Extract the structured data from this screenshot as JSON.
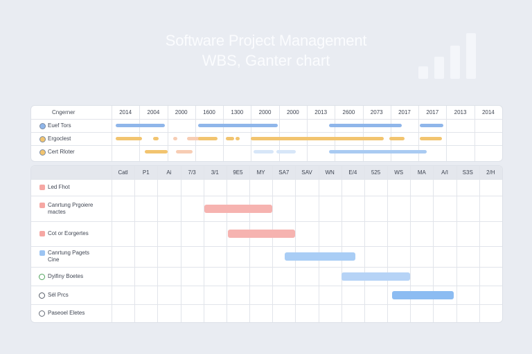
{
  "header": {
    "title": "Software Project Management",
    "subtitle": "WBS, Ganter chart"
  },
  "chart_data": [
    {
      "type": "gantt",
      "corner_label": "Cngerner",
      "columns": [
        "2014",
        "2004",
        "2000",
        "1600",
        "1300",
        "2000",
        "2000",
        "2013",
        "2600",
        "2073",
        "2017",
        "2017",
        "2013",
        "2014"
      ],
      "rows": [
        {
          "label": "Euef Tors",
          "marker": "dot",
          "color": "#8fb6ea",
          "segments": [
            [
              0.15,
              1.9
            ],
            [
              3.1,
              5.95
            ],
            [
              7.8,
              10.4
            ],
            [
              11.05,
              11.9
            ]
          ]
        },
        {
          "label": "Ergoclest",
          "marker": "dot",
          "color": "#f2c46f",
          "segments": [
            [
              0.15,
              1.1
            ],
            [
              1.5,
              1.7
            ],
            [
              2.2,
              2.35
            ],
            [
              2.7,
              3.3
            ],
            [
              3.1,
              3.8
            ],
            [
              4.1,
              4.4
            ],
            [
              4.45,
              4.6
            ],
            [
              5.0,
              9.75
            ],
            [
              9.95,
              10.5
            ],
            [
              11.05,
              11.85
            ]
          ]
        },
        {
          "label": "Cert Rloter",
          "marker": "dot",
          "color": "#f2c46f",
          "segments": [
            [
              1.2,
              2.0
            ],
            [
              2.3,
              2.9
            ],
            [
              5.1,
              5.8
            ],
            [
              5.9,
              6.6
            ],
            [
              7.8,
              11.3
            ]
          ]
        }
      ],
      "segment_colors": {
        "row2_extra": "#f7cdb4",
        "row3_light": "#d7e6f8"
      }
    },
    {
      "type": "gantt",
      "columns": [
        "Catl",
        "P1",
        "Ai",
        "7/3",
        "3/1",
        "9E5",
        "MY",
        "SA7",
        "SAV",
        "WN",
        "E/4",
        "525",
        "WS",
        "MA",
        "A/I",
        "S3S",
        "2/H"
      ],
      "corner_label": "",
      "rows": [
        {
          "label": "Led Fhot",
          "marker": "square",
          "color": "#f6a7a3",
          "start": null,
          "end": null
        },
        {
          "label": "Canrtung Prgoiere",
          "label2": "mactes",
          "marker": "square",
          "color": "#f6a7a3",
          "start": 4.05,
          "end": 7.0
        },
        {
          "label": "Cot or Eorgertes",
          "marker": "square",
          "color": "#f6a7a3",
          "start": 5.05,
          "end": 8.0
        },
        {
          "label": "Canrtung Pagets",
          "label2": "Cine",
          "marker": "square",
          "color": "#9cc4f2",
          "start": 7.55,
          "end": 10.6
        },
        {
          "label": "Dyifiny Boetes",
          "marker": "ring",
          "color": "#4fa25b",
          "start": 10.0,
          "end": 13.0
        },
        {
          "label": "Sél Prcs",
          "marker": "ring",
          "color": "#555b66",
          "start": 12.2,
          "end": 14.9
        },
        {
          "label": "Paseoel Eletes",
          "marker": "ring",
          "color": "#666c77",
          "start": null,
          "end": null
        }
      ],
      "bar_colors": [
        "#f6b3b0",
        "#f6b3b0",
        "#f6b3b0",
        "#a9cdf5",
        "#b6d3f6",
        "#8cbcf2",
        "#8cbcf2"
      ]
    }
  ]
}
